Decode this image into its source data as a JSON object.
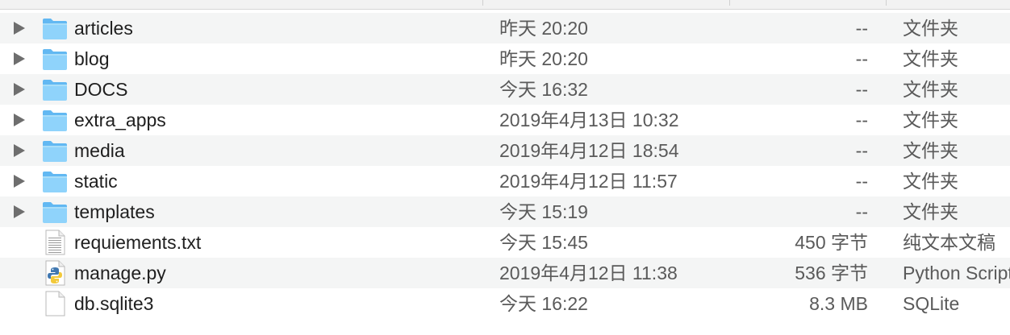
{
  "columns": {
    "name": "",
    "date_modified": "",
    "size": "",
    "kind": ""
  },
  "files": [
    {
      "name": "articles",
      "date": "昨天 20:20",
      "size": "--",
      "kind": "文件夹",
      "type": "folder",
      "icon": "folder-icon"
    },
    {
      "name": "blog",
      "date": "昨天 20:20",
      "size": "--",
      "kind": "文件夹",
      "type": "folder",
      "icon": "folder-icon"
    },
    {
      "name": "DOCS",
      "date": "今天 16:32",
      "size": "--",
      "kind": "文件夹",
      "type": "folder",
      "icon": "folder-icon"
    },
    {
      "name": "extra_apps",
      "date": "2019年4月13日 10:32",
      "size": "--",
      "kind": "文件夹",
      "type": "folder",
      "icon": "folder-icon"
    },
    {
      "name": "media",
      "date": "2019年4月12日 18:54",
      "size": "--",
      "kind": "文件夹",
      "type": "folder",
      "icon": "folder-icon"
    },
    {
      "name": "static",
      "date": "2019年4月12日 11:57",
      "size": "--",
      "kind": "文件夹",
      "type": "folder",
      "icon": "folder-icon"
    },
    {
      "name": "templates",
      "date": "今天 15:19",
      "size": "--",
      "kind": "文件夹",
      "type": "folder",
      "icon": "folder-icon"
    },
    {
      "name": "requiements.txt",
      "date": "今天 15:45",
      "size": "450 字节",
      "kind": "纯文本文稿",
      "type": "text",
      "icon": "text-file-icon"
    },
    {
      "name": "manage.py",
      "date": "2019年4月12日 11:38",
      "size": "536 字节",
      "kind": "Python Script",
      "type": "python",
      "icon": "python-file-icon"
    },
    {
      "name": "db.sqlite3",
      "date": "今天 16:22",
      "size": "8.3 MB",
      "kind": "SQLite",
      "type": "blank",
      "icon": "blank-file-icon"
    }
  ],
  "colors": {
    "folder_light": "#8fd3fb",
    "folder_dark": "#62b8f2",
    "row_alt": "#f4f5f5",
    "text_secondary": "#5a5a5a"
  }
}
